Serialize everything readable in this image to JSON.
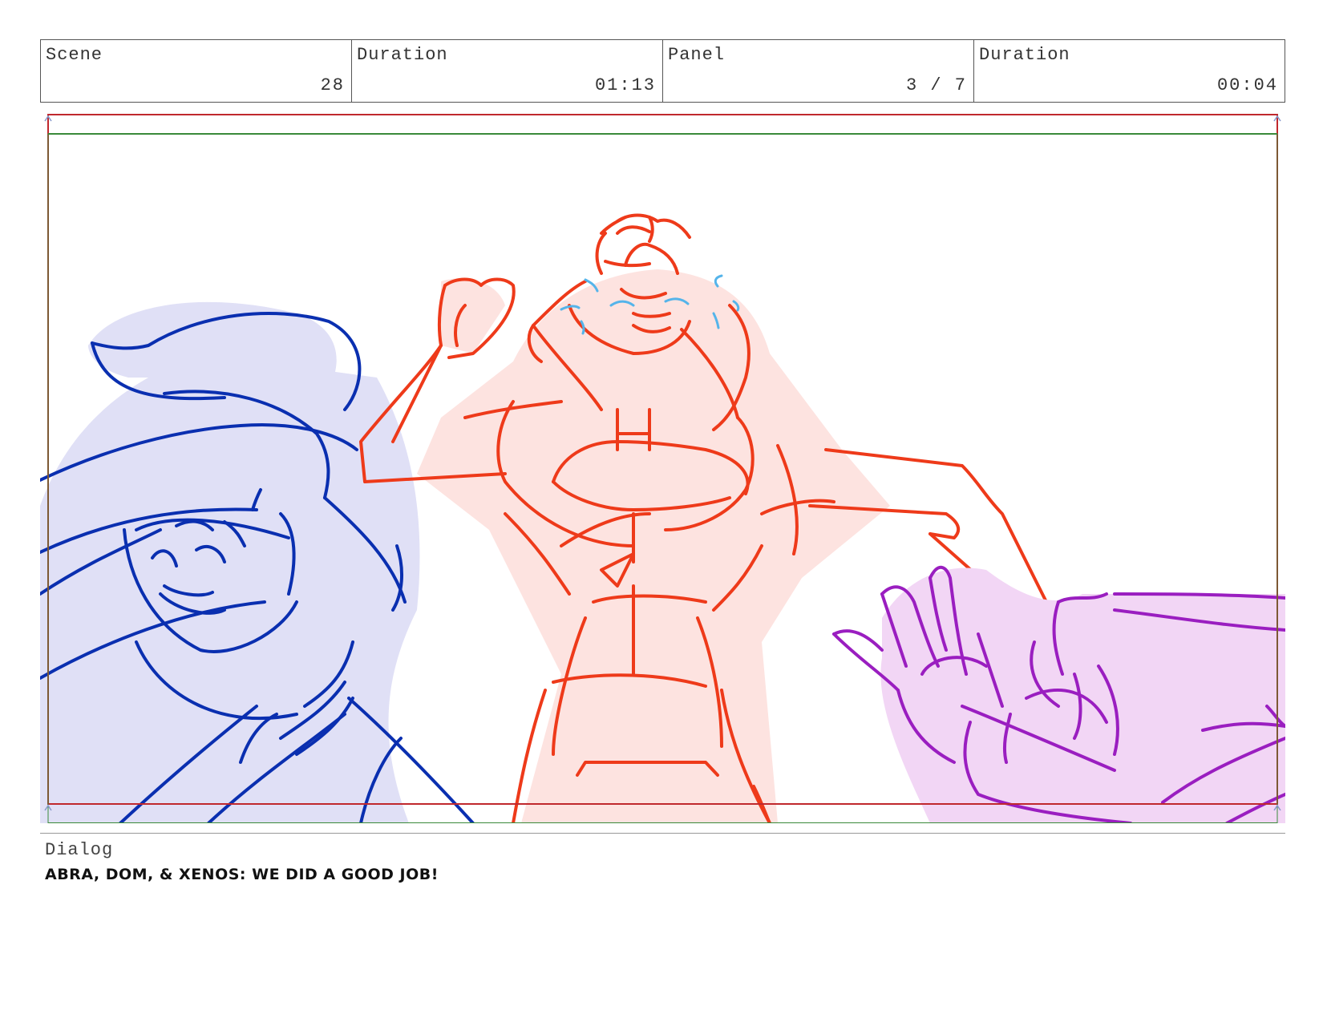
{
  "header": {
    "scene_label": "Scene",
    "scene_value": "28",
    "scene_duration_label": "Duration",
    "scene_duration_value": "01:13",
    "panel_label": "Panel",
    "panel_value": "3 / 7",
    "panel_duration_label": "Duration",
    "panel_duration_value": "00:04"
  },
  "colors": {
    "safe_frame": "#c0282d",
    "action_frame": "#3a8a3a",
    "character_left": "#0a2fb0",
    "character_center": "#ee3a1a",
    "character_right": "#9a1ec0",
    "tears": "#55b4ea"
  },
  "dialog": {
    "label": "Dialog",
    "text": "ABRA, DOM, & XENOS: WE DID A GOOD JOB!"
  }
}
